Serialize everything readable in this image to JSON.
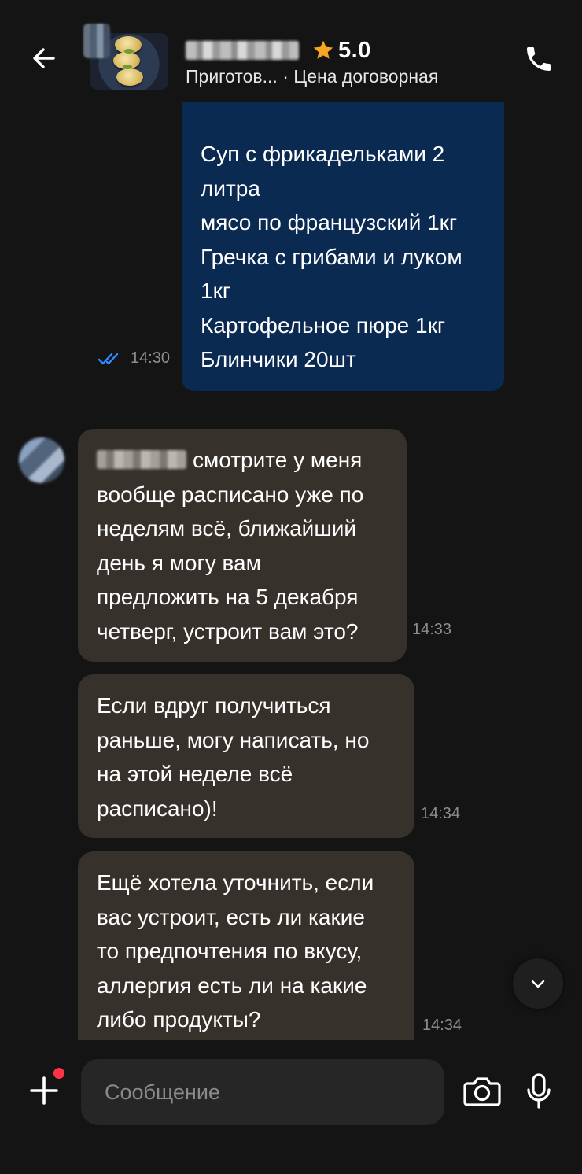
{
  "header": {
    "rating": "5.0",
    "subtitle_left": "Приготов...",
    "subtitle_right": "· Цена договорная",
    "icons": {
      "back": "back-arrow-icon",
      "star": "star-icon",
      "call": "phone-icon"
    },
    "star_color": "#f5a623"
  },
  "messages": [
    {
      "direction": "outgoing",
      "lines": [
        "Суп с фрикадельками 2",
        "литра",
        "мясо по французский 1кг",
        "Гречка с грибами и луком",
        "1кг",
        "Картофельное пюре 1кг",
        "Блинчики 20шт"
      ],
      "time": "14:30",
      "status_icon": "double-check-icon",
      "bubble_color": "#0b2a52"
    },
    {
      "direction": "incoming",
      "lines": [
        "смотрите у меня",
        "вообще расписано уже по",
        "неделям всё, ближайший",
        "день я могу вам",
        "предложить на 5 декабря",
        "четверг, устроит вам это?"
      ],
      "time": "14:33",
      "bubble_color": "#36312b"
    },
    {
      "direction": "incoming",
      "lines": [
        "Если вдруг получиться",
        "раньше, могу написать, но",
        "на этой неделе всё",
        "расписано)!"
      ],
      "time": "14:34"
    },
    {
      "direction": "incoming",
      "lines": [
        "Ещё хотела уточнить, если",
        "вас устроит, есть ли какие",
        "то предпочтения по вкусу,",
        "аллергия есть ли на какие",
        "либо продукты?"
      ],
      "time": "14:34"
    }
  ],
  "composer": {
    "placeholder": "Сообщение",
    "icons": {
      "add": "plus-icon",
      "camera": "camera-icon",
      "mic": "microphone-icon"
    },
    "notification_dot_color": "#ff3347"
  },
  "scroll_down_icon": "chevron-down-icon"
}
